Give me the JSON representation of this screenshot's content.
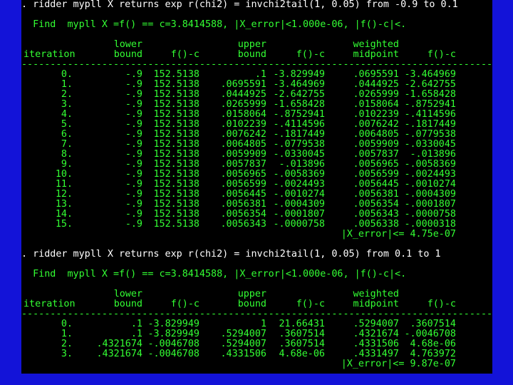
{
  "block1": {
    "command": ". ridder mypll X returns exp r(chi2) = invchi2tail(1, 0.05) from -0.9 to 0.1",
    "find": "  Find  mypll X =f() == c=3.8414588, |X_error|<1.000e-06, |f()-c|<.",
    "header1": [
      "",
      "lower",
      "",
      "upper",
      "",
      "weighted",
      ""
    ],
    "header2": [
      "iteration",
      "bound",
      "f()-c",
      "bound",
      "f()-c",
      "midpoint",
      "f()-c"
    ],
    "rows": [
      [
        "0.",
        "-.9",
        "152.5138",
        ".1",
        "-3.829949",
        ".0695591",
        "-3.464969"
      ],
      [
        "1.",
        "-.9",
        "152.5138",
        ".0695591",
        "-3.464969",
        ".0444925",
        "-2.642755"
      ],
      [
        "2.",
        "-.9",
        "152.5138",
        ".0444925",
        "-2.642755",
        ".0265999",
        "-1.658428"
      ],
      [
        "3.",
        "-.9",
        "152.5138",
        ".0265999",
        "-1.658428",
        ".0158064",
        "-.8752941"
      ],
      [
        "4.",
        "-.9",
        "152.5138",
        ".0158064",
        "-.8752941",
        ".0102239",
        "-.4114596"
      ],
      [
        "5.",
        "-.9",
        "152.5138",
        ".0102239",
        "-.4114596",
        ".0076242",
        "-.1817449"
      ],
      [
        "6.",
        "-.9",
        "152.5138",
        ".0076242",
        "-.1817449",
        ".0064805",
        "-.0779538"
      ],
      [
        "7.",
        "-.9",
        "152.5138",
        ".0064805",
        "-.0779538",
        ".0059909",
        "-.0330045"
      ],
      [
        "8.",
        "-.9",
        "152.5138",
        ".0059909",
        "-.0330045",
        ".0057837",
        "-.013896"
      ],
      [
        "9.",
        "-.9",
        "152.5138",
        ".0057837",
        "-.013896",
        ".0056965",
        "-.0058369"
      ],
      [
        "10.",
        "-.9",
        "152.5138",
        ".0056965",
        "-.0058369",
        ".0056599",
        "-.0024493"
      ],
      [
        "11.",
        "-.9",
        "152.5138",
        ".0056599",
        "-.0024493",
        ".0056445",
        "-.0010274"
      ],
      [
        "12.",
        "-.9",
        "152.5138",
        ".0056445",
        "-.0010274",
        ".0056381",
        "-.0004309"
      ],
      [
        "13.",
        "-.9",
        "152.5138",
        ".0056381",
        "-.0004309",
        ".0056354",
        "-.0001807"
      ],
      [
        "14.",
        "-.9",
        "152.5138",
        ".0056354",
        "-.0001807",
        ".0056343",
        "-.0000758"
      ],
      [
        "15.",
        "-.9",
        "152.5138",
        ".0056343",
        "-.0000758",
        ".0056338",
        "-.0000318"
      ]
    ],
    "summary": "|X_error|<= 4.75e-07"
  },
  "block2": {
    "command": ". ridder mypll X returns exp r(chi2) = invchi2tail(1, 0.05) from 0.1 to 1",
    "find": "  Find  mypll X =f() == c=3.8414588, |X_error|<1.000e-06, |f()-c|<.",
    "header1": [
      "",
      "lower",
      "",
      "upper",
      "",
      "weighted",
      ""
    ],
    "header2": [
      "iteration",
      "bound",
      "f()-c",
      "bound",
      "f()-c",
      "midpoint",
      "f()-c"
    ],
    "rows": [
      [
        "0.",
        ".1",
        "-3.829949",
        "1",
        "21.66431",
        ".5294007",
        ".3607514"
      ],
      [
        "1.",
        ".1",
        "-3.829949",
        ".5294007",
        ".3607514",
        ".4321674",
        "-.0046708"
      ],
      [
        "2.",
        ".4321674",
        "-.0046708",
        ".5294007",
        ".3607514",
        ".4331506",
        "4.68e-06"
      ],
      [
        "3.",
        ".4321674",
        "-.0046708",
        ".4331506",
        "4.68e-06",
        ".4331497",
        "4.763972"
      ]
    ],
    "summary": "|X_error|<= 9.87e-07"
  },
  "colors": {
    "background": "#1313d8",
    "console": "#000000",
    "command_text": "#ffffff",
    "output_text": "#33ff33"
  }
}
